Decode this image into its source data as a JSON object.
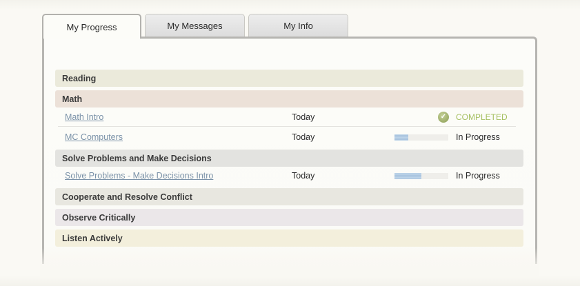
{
  "tabs": [
    {
      "label": "My Progress",
      "active": true
    },
    {
      "label": "My Messages",
      "active": false
    },
    {
      "label": "My Info",
      "active": false
    }
  ],
  "categories": {
    "reading": {
      "label": "Reading",
      "color": "#ebeadb"
    },
    "math": {
      "label": "Math",
      "color": "#ece1d8"
    },
    "solve": {
      "label": "Solve Problems and Make Decisions",
      "color": "#e3e3e0"
    },
    "cooperate": {
      "label": "Cooperate and Resolve Conflict",
      "color": "#e8e7e0"
    },
    "observe": {
      "label": "Observe Critically",
      "color": "#ebe7e9"
    },
    "listen": {
      "label": "Listen Actively",
      "color": "#f3efdc"
    }
  },
  "lessons": {
    "math_intro": {
      "title": "Math Intro",
      "date": "Today",
      "status": "COMPLETED",
      "icon": "check-circle-icon"
    },
    "mc_computers": {
      "title": "MC Computers",
      "date": "Today",
      "status": "In Progress",
      "progress": 0.25
    },
    "solve_intro": {
      "title": "Solve Problems - Make Decisions Intro",
      "date": "Today",
      "status": "In Progress",
      "progress": 0.5
    }
  },
  "colors": {
    "completed": "#a6c061",
    "link": "#7b92a8",
    "progress_fill": "#a9c4df"
  }
}
